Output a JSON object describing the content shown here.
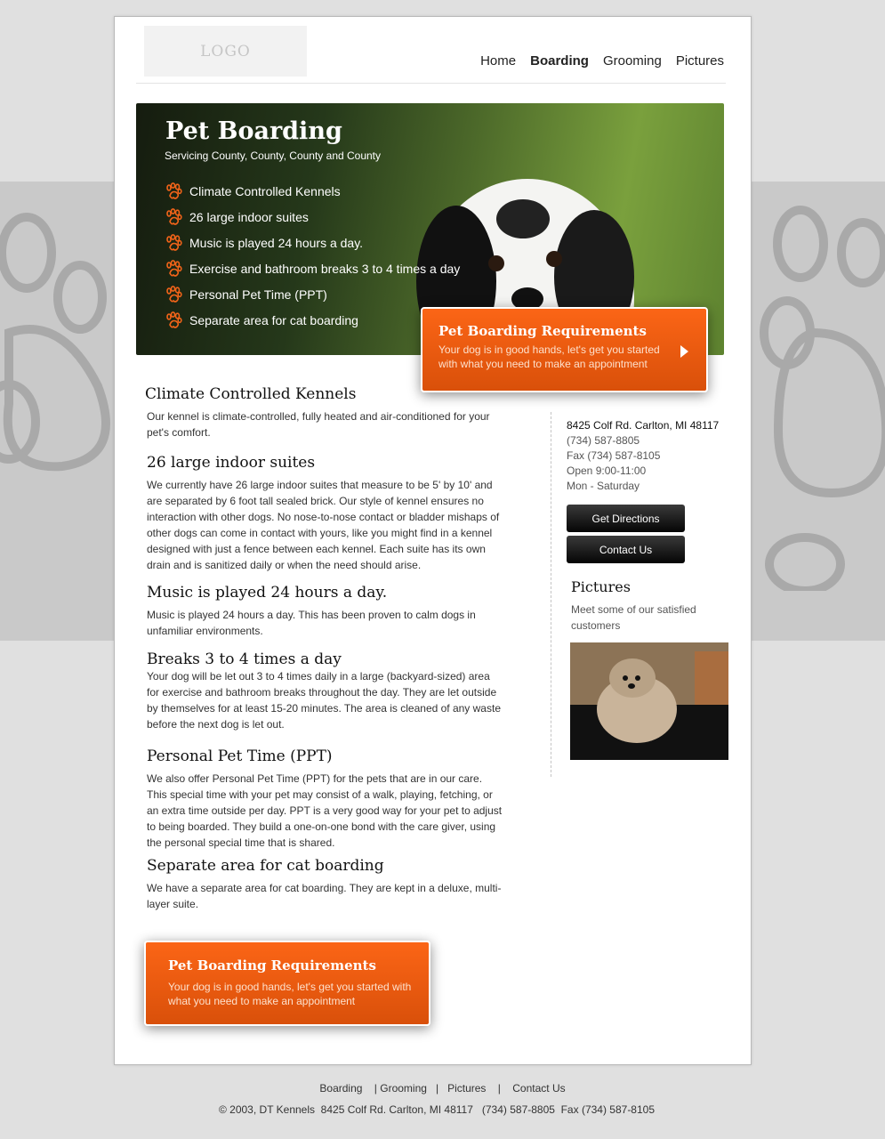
{
  "nav": {
    "logo": "LOGO",
    "items": [
      {
        "label": "Home",
        "active": false
      },
      {
        "label": "Boarding",
        "active": true
      },
      {
        "label": "Grooming",
        "active": false
      },
      {
        "label": "Pictures",
        "active": false
      }
    ]
  },
  "hero": {
    "title": "Pet Boarding",
    "subtitle": "Servicing County, County, County and County",
    "features": [
      "Climate Controlled Kennels",
      "26 large indoor suites",
      "Music is played 24 hours a day.",
      "Exercise and bathroom breaks 3 to 4 times a day",
      "Personal Pet Time (PPT)",
      "Separate area for cat boarding"
    ],
    "icon": "paw-icon"
  },
  "cta": {
    "title": "Pet Boarding Requirements",
    "text_top": "Your dog is in good hands, let's get you started with what you need to make an appointment",
    "text_bottom": "Your dog is in good hands, let's get you started with what you need to make an appointment"
  },
  "sections": [
    {
      "title": "Climate Controlled Kennels",
      "body": "Our kennel is climate-controlled, fully heated and air-conditioned for your pet's comfort."
    },
    {
      "title": "26 large indoor suites",
      "body": "We currently have 26 large indoor suites that measure to be 5' by 10' and are separated by 6 foot tall sealed brick. Our style of kennel ensures no interaction with other dogs. No nose-to-nose contact or bladder mishaps of other dogs can come in contact with yours, like you might find in a kennel designed with just a fence between each kennel. Each suite has its own drain and is sanitized daily or when the need should arise."
    },
    {
      "title": "Music is played 24 hours a day.",
      "body": "Music is played 24 hours a day. This has been proven to calm dogs in unfamiliar environments."
    },
    {
      "title": "Breaks 3 to 4 times a day",
      "body": "Your dog will be let out 3 to 4 times daily in a large (backyard-sized) area for exercise and bathroom breaks throughout the day. They are let outside by themselves for at least 15-20 minutes. The area is cleaned of any waste before the next dog is let out."
    },
    {
      "title": "Personal Pet Time (PPT)",
      "body": "We also offer Personal Pet Time (PPT) for the pets that are in our care. This special time with your pet may consist of a walk, playing, fetching, or an extra time outside per day. PPT is a very good way for your pet to adjust to being boarded. They build a one-on-one bond with the care giver, using the personal special time that is shared."
    },
    {
      "title": "Separate area for cat boarding",
      "body": "We have a separate area for cat boarding. They are kept in a deluxe, multi-layer suite."
    }
  ],
  "sidebar": {
    "address": "8425 Colf Rd. Carlton, MI 48117",
    "phone": "(734) 587-8805",
    "fax": "Fax (734) 587-8105",
    "hours": "Open 9:00-11:00",
    "days": "Mon - Saturday",
    "directions_label": "Get Directions",
    "contact_label": "Contact Us",
    "pictures_title": "Pictures",
    "pictures_text": "Meet some of our satisfied customers"
  },
  "footer": {
    "links": [
      "Boarding",
      "Grooming",
      "Pictures",
      "Contact Us"
    ],
    "copyright": "© 2003, DT Kennels  8425 Colf Rd. Carlton, MI 48117   (734) 587-8805  Fax (734) 587-8105"
  },
  "colors": {
    "accent": "#f26419",
    "band": "#c9c9c9",
    "background": "#e0e0e0"
  }
}
